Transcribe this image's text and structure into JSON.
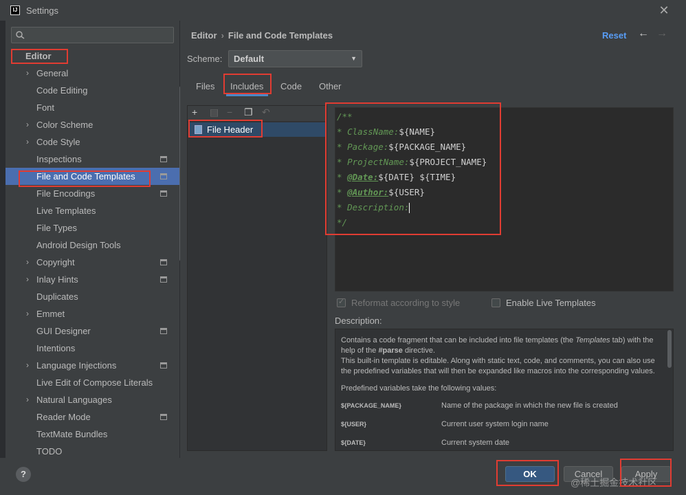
{
  "window": {
    "title": "Settings",
    "app_icon": "IJ"
  },
  "sidebar": {
    "search_placeholder": "",
    "items": [
      {
        "label": "Editor",
        "level": "top",
        "chevron": false,
        "project_icon": false
      },
      {
        "label": "General",
        "chevron": true,
        "project_icon": false
      },
      {
        "label": "Code Editing",
        "chevron": false,
        "project_icon": false
      },
      {
        "label": "Font",
        "chevron": false,
        "project_icon": false
      },
      {
        "label": "Color Scheme",
        "chevron": true,
        "project_icon": false
      },
      {
        "label": "Code Style",
        "chevron": true,
        "project_icon": false
      },
      {
        "label": "Inspections",
        "chevron": false,
        "project_icon": true
      },
      {
        "label": "File and Code Templates",
        "chevron": false,
        "project_icon": true,
        "selected": true
      },
      {
        "label": "File Encodings",
        "chevron": false,
        "project_icon": true
      },
      {
        "label": "Live Templates",
        "chevron": false,
        "project_icon": false
      },
      {
        "label": "File Types",
        "chevron": false,
        "project_icon": false
      },
      {
        "label": "Android Design Tools",
        "chevron": false,
        "project_icon": false
      },
      {
        "label": "Copyright",
        "chevron": true,
        "project_icon": true
      },
      {
        "label": "Inlay Hints",
        "chevron": true,
        "project_icon": true
      },
      {
        "label": "Duplicates",
        "chevron": false,
        "project_icon": false
      },
      {
        "label": "Emmet",
        "chevron": true,
        "project_icon": false
      },
      {
        "label": "GUI Designer",
        "chevron": false,
        "project_icon": true
      },
      {
        "label": "Intentions",
        "chevron": false,
        "project_icon": false
      },
      {
        "label": "Language Injections",
        "chevron": true,
        "project_icon": true
      },
      {
        "label": "Live Edit of Compose Literals",
        "chevron": false,
        "project_icon": false
      },
      {
        "label": "Natural Languages",
        "chevron": true,
        "project_icon": false
      },
      {
        "label": "Reader Mode",
        "chevron": false,
        "project_icon": true
      },
      {
        "label": "TextMate Bundles",
        "chevron": false,
        "project_icon": false
      },
      {
        "label": "TODO",
        "chevron": false,
        "project_icon": false
      }
    ]
  },
  "header": {
    "breadcrumb": [
      "Editor",
      "File and Code Templates"
    ],
    "reset_label": "Reset",
    "back_icon": "arrow-left-icon",
    "forward_icon": "arrow-right-icon"
  },
  "scheme": {
    "label": "Scheme:",
    "value": "Default"
  },
  "tabs": [
    "Files",
    "Includes",
    "Code",
    "Other"
  ],
  "active_tab": "Includes",
  "template_list": {
    "items": [
      "File Header"
    ]
  },
  "editor": {
    "lines": [
      {
        "prefix": "/**",
        "tag": "",
        "var": ""
      },
      {
        "prefix": "* ",
        "tag": "ClassName:",
        "var": "${NAME}"
      },
      {
        "prefix": "* ",
        "tag": "Package:",
        "var": "${PACKAGE_NAME}"
      },
      {
        "prefix": "* ",
        "tag": "ProjectName:",
        "var": "${PROJECT_NAME}"
      },
      {
        "prefix": "* ",
        "tag": "@Date:",
        "var": "${DATE} ${TIME}"
      },
      {
        "prefix": "* ",
        "tag": "@Author:",
        "var": "${USER}"
      },
      {
        "prefix": "* ",
        "tag": "Description:",
        "var": ""
      },
      {
        "prefix": "*/",
        "tag": "",
        "var": ""
      }
    ]
  },
  "options": {
    "reformat_label": "Reformat according to style",
    "reformat_checked": true,
    "live_templates_label": "Enable Live Templates",
    "live_templates_checked": false
  },
  "description": {
    "label": "Description:",
    "p1_a": "Contains a code fragment that can be included into file templates (the ",
    "p1_em": "Templates",
    "p1_b": " tab) with the help of the ",
    "p1_bold": "#parse",
    "p1_c": " directive.",
    "p2": "This built-in template is editable. Along with static text, code, and comments, you can also use the predefined variables that will then be expanded like macros into the corresponding values.",
    "p3": "Predefined variables take the following values:",
    "vars": [
      {
        "key": "${PACKAGE_NAME}",
        "desc": "Name of the package in which the new file is created"
      },
      {
        "key": "${USER}",
        "desc": "Current user system login name"
      },
      {
        "key": "${DATE}",
        "desc": "Current system date"
      }
    ]
  },
  "footer": {
    "help_label": "?",
    "ok_label": "OK",
    "cancel_label": "Cancel",
    "apply_label": "Apply",
    "watermark": "@稀土掘金技术社区"
  }
}
